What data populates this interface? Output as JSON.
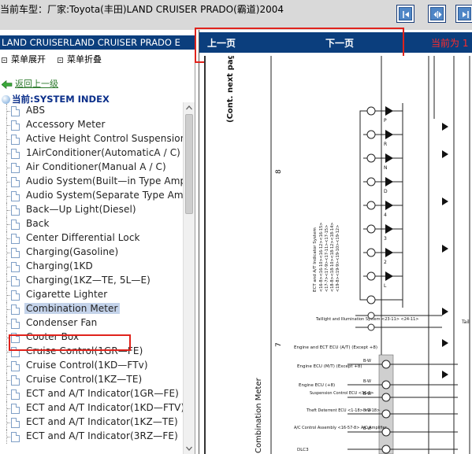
{
  "window": {
    "title": "当前车型：厂家:Toyota(丰田)LAND CRUISER PRADO(霸道)2004"
  },
  "toolbar": {
    "icons": [
      "expand-left-icon",
      "expand-both-icon",
      "collapse-right-icon"
    ]
  },
  "sidebar": {
    "header": "LAND CRUISERLAND CRUISER PRADO E",
    "expand_all": "菜单展开",
    "collapse_all": "菜单折叠",
    "back_link": "返回上一级",
    "current_label": "当前:SYSTEM INDEX",
    "items": [
      {
        "label": "ABS"
      },
      {
        "label": "Accessory Meter"
      },
      {
        "label": "Active Height Control Suspension"
      },
      {
        "label": "1AirConditioner(AutomaticA / C)"
      },
      {
        "label": "Air Conditioner(Manual A / C)"
      },
      {
        "label": "Audio System(Built—in Type Ampli"
      },
      {
        "label": "Audio System(Separate Type Amp"
      },
      {
        "label": "Back—Up Light(Diesel)"
      },
      {
        "label": "Back"
      },
      {
        "label": "Center Differential Lock"
      },
      {
        "label": "Charging(Gasoline)"
      },
      {
        "label": "Charging(1KD"
      },
      {
        "label": "Charging(1KZ—TE, 5L—E)"
      },
      {
        "label": "Cigarette Lighter"
      },
      {
        "label": "Combination Meter",
        "selected": true
      },
      {
        "label": "Condenser Fan"
      },
      {
        "label": "Cooter Box"
      },
      {
        "label": "Cruise Control(1GR—FE)"
      },
      {
        "label": "Cruise Control(1KD—FTv)"
      },
      {
        "label": "Cruise Control(1KZ—TE)"
      },
      {
        "label": "ECT and A/T Indicator(1GR—FE)"
      },
      {
        "label": "ECT and A/T Indicator(1KD—FTV)"
      },
      {
        "label": "ECT and A/T Indicator(1KZ—TE)"
      },
      {
        "label": "ECT and A/T Indicator(3RZ—FE)"
      }
    ]
  },
  "viewer": {
    "prev": "上一页",
    "next": "下一页",
    "current_page": "当前为 1",
    "diagram": {
      "vertical_top": "(Cont. next page)",
      "vertical_bottom": "Combination Meter",
      "col_num_8": "8",
      "col_num_7": "7",
      "block_ect": "ECT and A/T Indicator System",
      "block_taillight": "Taillight and Illumination System <23-11> <24-11>",
      "block_engine_ect": "Engine and ECT ECU (A/T) (Except +8)",
      "block_engine_mt": "Engine ECU (M/T) (Except +8)",
      "block_engine_8": "Engine ECU (+8)",
      "block_suspension": "Suspension Control ECU <36-6>",
      "block_theft": "Theft Deterrent ECU <1-18> <2-18>",
      "block_ac": "A/C Control Assembly <16-57-8> A/C Amplifier",
      "block_dlc": "DLC3",
      "wire_bw": "B-W",
      "gear_labels": [
        "P",
        "R",
        "N",
        "D",
        "4",
        "3",
        "2",
        "L"
      ],
      "tail_label": "Tail"
    }
  }
}
